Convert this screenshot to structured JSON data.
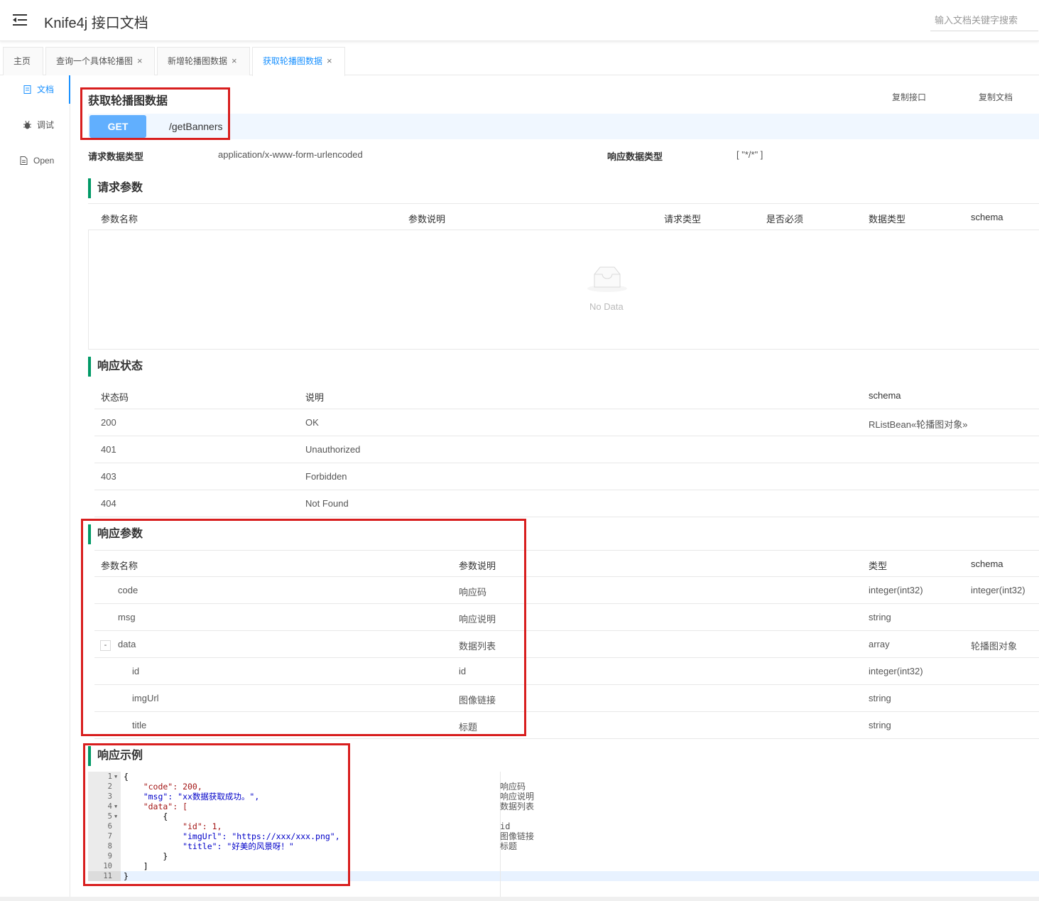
{
  "header": {
    "title": "Knife4j 接口文档",
    "search_placeholder": "输入文档关键字搜索"
  },
  "tabs": [
    {
      "label": "主页",
      "closable": false
    },
    {
      "label": "查询一个具体轮播图",
      "closable": true
    },
    {
      "label": "新增轮播图数据",
      "closable": true
    },
    {
      "label": "获取轮播图数据",
      "closable": true,
      "active": true
    }
  ],
  "tab_close_glyph": "×",
  "sidebar": [
    {
      "label": "文档",
      "icon": "document-icon",
      "active": true
    },
    {
      "label": "调试",
      "icon": "bug-icon"
    },
    {
      "label": "Open",
      "icon": "file-icon"
    }
  ],
  "api": {
    "title": "获取轮播图数据",
    "copy_api": "复制接口",
    "copy_doc": "复制文档",
    "method": "GET",
    "path": "/getBanners",
    "req_type_label": "请求数据类型",
    "req_type_value": "application/x-www-form-urlencoded",
    "resp_type_label": "响应数据类型",
    "resp_type_value": "[ \"*/*\" ]"
  },
  "request_params": {
    "title": "请求参数",
    "headers": [
      "参数名称",
      "参数说明",
      "请求类型",
      "是否必须",
      "数据类型",
      "schema"
    ],
    "empty_text": "No Data"
  },
  "response_status": {
    "title": "响应状态",
    "headers": [
      "状态码",
      "说明",
      "schema"
    ],
    "rows": [
      {
        "code": "200",
        "desc": "OK",
        "schema": "RListBean«轮播图对象»"
      },
      {
        "code": "401",
        "desc": "Unauthorized",
        "schema": ""
      },
      {
        "code": "403",
        "desc": "Forbidden",
        "schema": ""
      },
      {
        "code": "404",
        "desc": "Not Found",
        "schema": ""
      }
    ]
  },
  "response_params": {
    "title": "响应参数",
    "headers": [
      "参数名称",
      "参数说明",
      "类型",
      "schema"
    ],
    "collapse_glyph": "-",
    "rows": [
      {
        "name": "code",
        "desc": "响应码",
        "type": "integer(int32)",
        "schema": "integer(int32)"
      },
      {
        "name": "msg",
        "desc": "响应说明",
        "type": "string",
        "schema": ""
      },
      {
        "name": "data",
        "desc": "数据列表",
        "type": "array",
        "schema": "轮播图对象"
      },
      {
        "name": "id",
        "desc": "id",
        "type": "integer(int32)",
        "schema": ""
      },
      {
        "name": "imgUrl",
        "desc": "图像链接",
        "type": "string",
        "schema": ""
      },
      {
        "name": "title",
        "desc": "标题",
        "type": "string",
        "schema": ""
      }
    ]
  },
  "response_example": {
    "title": "响应示例",
    "line_numbers": [
      "1",
      "2",
      "3",
      "4",
      "5",
      "6",
      "7",
      "8",
      "9",
      "10",
      "11"
    ],
    "lines": [
      "{",
      "    \"code\": 200,",
      "    \"msg\": \"xx数据获取成功。\",",
      "    \"data\": [",
      "        {",
      "            \"id\": 1,",
      "            \"imgUrl\": \"https://xxx/xxx.png\",",
      "            \"title\": \"好美的风景呀！\"",
      "        }",
      "    ]",
      "}"
    ],
    "comments": [
      "",
      "响应码",
      "响应说明",
      "数据列表",
      "",
      "id",
      "图像链接",
      "标题",
      "",
      "",
      ""
    ]
  }
}
